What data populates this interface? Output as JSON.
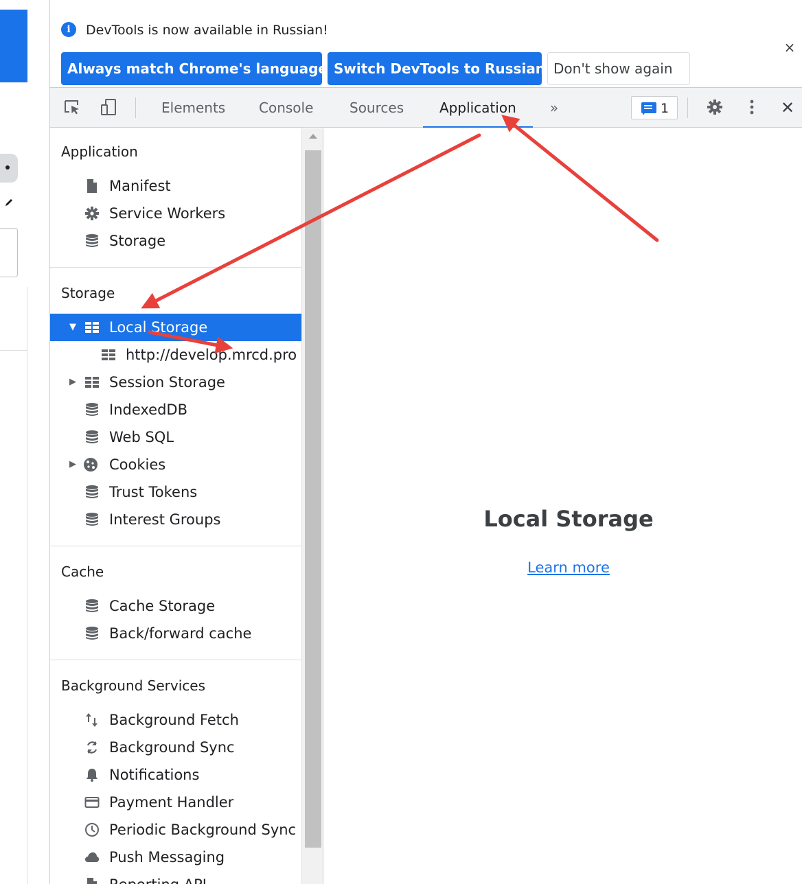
{
  "infobar": {
    "message": "DevTools is now available in Russian!",
    "always_match": "Always match Chrome's language",
    "switch": "Switch DevTools to Russian",
    "dont_show": "Don't show again",
    "close": "×"
  },
  "toolbar": {
    "tabs": [
      "Elements",
      "Console",
      "Sources",
      "Application"
    ],
    "active_tab": "Application",
    "more": "»",
    "issues_count": "1",
    "close": "✕"
  },
  "sidebar": {
    "application": {
      "title": "Application",
      "items": [
        "Manifest",
        "Service Workers",
        "Storage"
      ]
    },
    "storage": {
      "title": "Storage",
      "items": [
        "Local Storage",
        "http://develop.mrcd.pro",
        "Session Storage",
        "IndexedDB",
        "Web SQL",
        "Cookies",
        "Trust Tokens",
        "Interest Groups"
      ]
    },
    "cache": {
      "title": "Cache",
      "items": [
        "Cache Storage",
        "Back/forward cache"
      ]
    },
    "background": {
      "title": "Background Services",
      "items": [
        "Background Fetch",
        "Background Sync",
        "Notifications",
        "Payment Handler",
        "Periodic Background Sync",
        "Push Messaging",
        "Reporting API"
      ]
    }
  },
  "main": {
    "title": "Local Storage",
    "link": "Learn more"
  },
  "colors": {
    "accent": "#1a73e8",
    "annotation_arrow": "#e8413c"
  }
}
